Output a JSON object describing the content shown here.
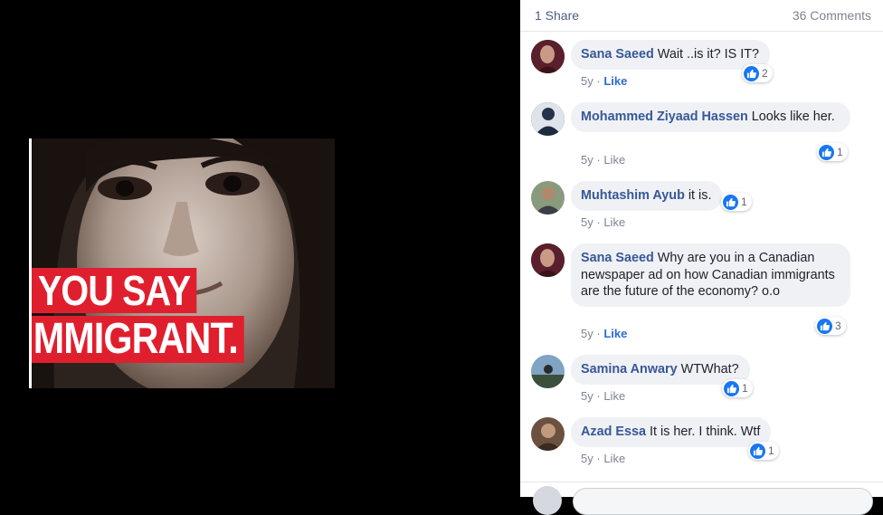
{
  "photo": {
    "caption_line1": "YOU SAY",
    "caption_line2": "MMIGRANT."
  },
  "stats": {
    "shares": "1 Share",
    "comments": "36 Comments"
  },
  "comments": [
    {
      "author": "Sana Saeed",
      "text": "Wait ..is it? IS IT?",
      "reactions": "2",
      "age": "5y",
      "like": "Like",
      "liked": true
    },
    {
      "author": "Mohammed Ziyaad Hassen",
      "text": "Looks like her.",
      "reactions": "1",
      "age": "5y",
      "like": "Like",
      "liked": false
    },
    {
      "author": "Muhtashim Ayub",
      "text": "it is.",
      "reactions": "1",
      "age": "5y",
      "like": "Like",
      "liked": false
    },
    {
      "author": "Sana Saeed",
      "text": "Why are you in a Canadian newspaper ad on how Canadian immigrants are the future of the economy? o.o",
      "reactions": "3",
      "age": "5y",
      "like": "Like",
      "liked": true
    },
    {
      "author": "Samina Anwary",
      "text": "WTWhat?",
      "reactions": "1",
      "age": "5y",
      "like": "Like",
      "liked": false
    },
    {
      "author": "Azad Essa",
      "text": "It is her. I think. Wtf",
      "reactions": "1",
      "age": "5y",
      "like": "Like",
      "liked": false
    }
  ],
  "dot_separator": "·",
  "icons": {
    "reaction": "thumbs-up-icon"
  },
  "colors": {
    "author": "#385898",
    "like_badge": "#1877f2",
    "caption_red": "#e01f2e",
    "bubble": "#eff1f5"
  }
}
